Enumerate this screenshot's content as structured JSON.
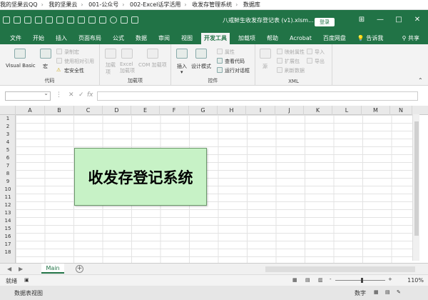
{
  "breadcrumb": [
    "我的坚果云QQ",
    "我的坚果云",
    "001-公众号",
    "002-Excel话学活用",
    "收发存管理系统",
    "数据库"
  ],
  "titlebar": {
    "filename": "八戒鲜生收发存登记表 (v1).xlsm...",
    "login_label": "登录",
    "controls": {
      "minimize": "—",
      "restore": "□",
      "close": "✕",
      "ribbon_display": "⊞"
    }
  },
  "tabs": [
    "文件",
    "开始",
    "插入",
    "页面布局",
    "公式",
    "数据",
    "审阅",
    "视图",
    "开发工具",
    "加载项",
    "帮助",
    "Acrobat",
    "百度网盘"
  ],
  "active_tab": "开发工具",
  "tell_me": "告诉我",
  "share": "共享",
  "ribbon": {
    "code": {
      "label": "代码",
      "visual_basic": "Visual Basic",
      "macros": "宏",
      "record_macro": "录制宏",
      "relative_ref": "使用相对引用",
      "macro_security": "宏安全性"
    },
    "addins": {
      "label": "加载项",
      "addins": "加载项",
      "excel_addins": "Excel 加载项",
      "com_addins": "COM 加载项"
    },
    "controls": {
      "label": "控件",
      "insert": "插入",
      "design_mode": "设计模式",
      "properties": "属性",
      "view_code": "查看代码",
      "run_dialog": "运行对话框"
    },
    "xml": {
      "label": "XML",
      "source": "源",
      "map_properties": "映射属性",
      "expansion_packs": "扩展包",
      "refresh_data": "刷新数据",
      "import": "导入",
      "export": "导出"
    }
  },
  "formula_bar": {
    "cancel": "✕",
    "enter": "✓",
    "fx": "fx",
    "value": ""
  },
  "columns": [
    "A",
    "B",
    "C",
    "D",
    "E",
    "F",
    "G",
    "H",
    "I",
    "J",
    "K",
    "L",
    "M",
    "N"
  ],
  "rows": [
    "1",
    "2",
    "3",
    "4",
    "5",
    "6",
    "7",
    "8",
    "9",
    "10",
    "11",
    "12",
    "13",
    "14",
    "15",
    "16",
    "17",
    "18"
  ],
  "shape_text": "收发存登记系统",
  "sheet_tab": "Main",
  "status": {
    "ready": "就绪",
    "zoom": "110%",
    "zoom_minus": "-",
    "zoom_plus": "+"
  },
  "taskbar": {
    "left": "数据表视图",
    "right": "数字"
  },
  "colors": {
    "excel_green": "#217346",
    "shape_fill": "#c7f2c6"
  }
}
